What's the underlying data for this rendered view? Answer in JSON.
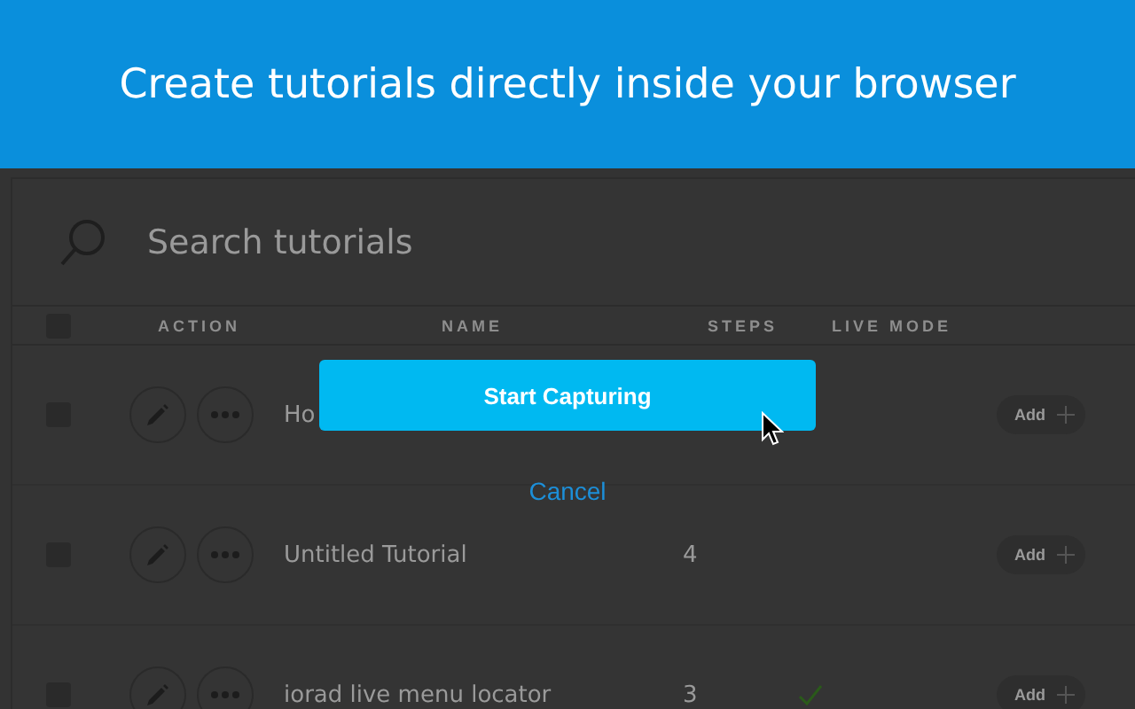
{
  "banner": {
    "title": "Create tutorials directly inside your browser"
  },
  "search": {
    "placeholder": "Search tutorials"
  },
  "table": {
    "select_all": {
      "checked": false
    },
    "columns": [
      "ACTION",
      "NAME",
      "STEPS",
      "LIVE MODE"
    ],
    "rows": [
      {
        "checked": false,
        "name": "Ho",
        "steps": "",
        "live": false,
        "add": "Add"
      },
      {
        "checked": false,
        "name": "Untitled Tutorial",
        "steps": "4",
        "live": false,
        "add": "Add"
      },
      {
        "checked": false,
        "name": "iorad live menu locator",
        "steps": "3",
        "live": true,
        "add": "Add"
      }
    ]
  },
  "dialog": {
    "primary": "Start Capturing",
    "cancel": "Cancel"
  }
}
